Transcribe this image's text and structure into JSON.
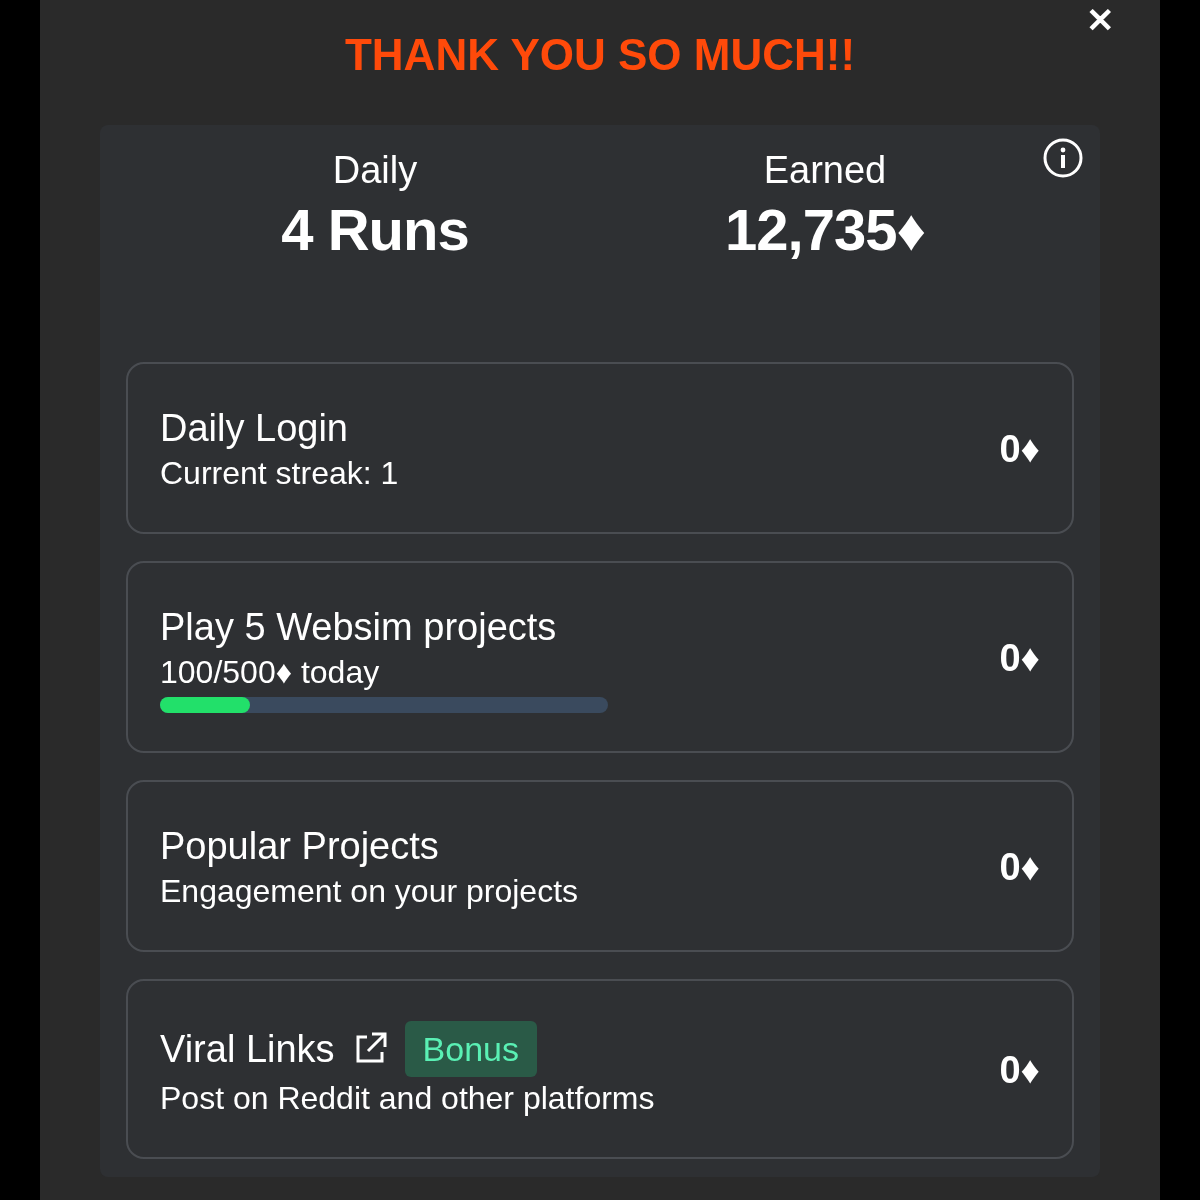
{
  "close": "✕",
  "title": "THANK YOU SO MUCH!!",
  "stats": [
    {
      "label": "Daily",
      "value": "4 Runs"
    },
    {
      "label": "Earned",
      "value": "12,735♦"
    }
  ],
  "tasks": [
    {
      "kind": "plain",
      "title": "Daily Login",
      "subtitle": "Current streak: 1",
      "reward": "0♦"
    },
    {
      "kind": "progress",
      "title": "Play 5 Websim projects",
      "subtitle": "100/500♦ today",
      "level": 0.2,
      "reward": "0♦"
    },
    {
      "kind": "plain",
      "title": "Popular Projects",
      "subtitle": "Engagement on your projects",
      "reward": "0♦"
    },
    {
      "kind": "link",
      "title": "Viral Links",
      "badge": "Bonus",
      "subtitle": "Post on Reddit and other platforms",
      "reward": "0♦"
    }
  ]
}
